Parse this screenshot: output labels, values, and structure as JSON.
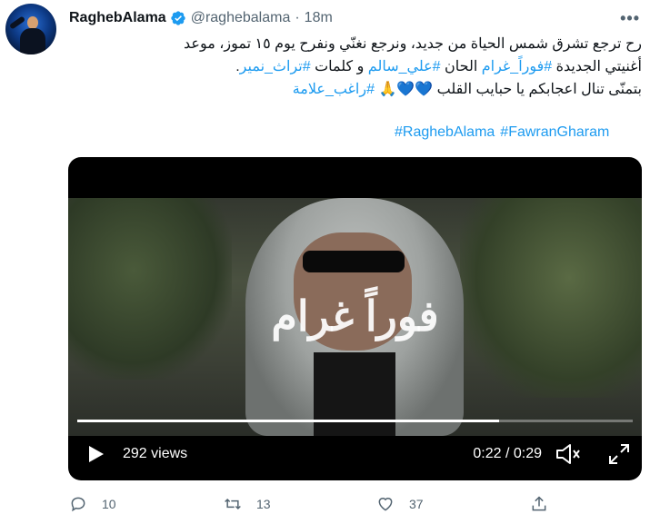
{
  "author": {
    "name": "RaghebAlama",
    "handle": "@raghebalama",
    "separator": "·",
    "time": "18m",
    "verified_icon": "verified-badge-icon"
  },
  "more_label": "•••",
  "tweet": {
    "line1": "رح ترجع تشرق شمس الحياة من جديد، ونرجع نغنّي ونفرح يوم ١٥ تموز، موعد",
    "line2_a": "أغنيتي الجديدة ",
    "line2_tag1": "#فوراً_غرام",
    "line2_b": " الحان ",
    "line2_tag2": "#علي_سالم",
    "line2_c": " و كلمات ",
    "line2_tag3": "#تراث_نمير",
    "line2_d": ".",
    "line3_a": "بتمنّى تنال اعجابكم يا حبايب القلب 💙💙🙏 ",
    "line3_tag": "#راغب_علامة",
    "hashtags": [
      "#RaghebAlama",
      "#FawranGharam"
    ]
  },
  "video": {
    "overlay_title": "فوراً غرام",
    "views": "292 views",
    "time": "0:22 / 0:29",
    "progress_fraction": 0.76
  },
  "actions": {
    "reply_count": "10",
    "retweet_count": "13",
    "like_count": "37"
  },
  "colors": {
    "accent": "#1d9bf0",
    "muted": "#536471",
    "text": "#0f1419"
  }
}
